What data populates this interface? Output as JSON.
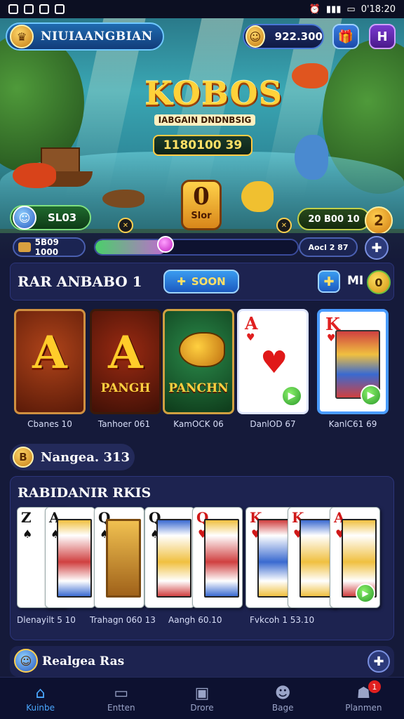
{
  "status_bar": {
    "time": "0'18:20"
  },
  "header": {
    "app_name": "NIUIAANGBIAN",
    "coins": "922.300",
    "menu_label": "H"
  },
  "hero": {
    "logo_title": "KOBOS",
    "logo_subtitle": "IABGAIN DNDNBSIG",
    "jackpot": "1180100 39",
    "slot_badge_number": "0",
    "slot_badge_label": "Slor",
    "slots_label": "SL03",
    "score": "20 B00 10",
    "score_bubble": "2"
  },
  "progress": {
    "balance": "5B09 1000",
    "level_text": "Aocl 2 87",
    "xp_fraction": 0.35
  },
  "section": {
    "title": "RAR ANBABO 1",
    "soon_button": "SOON",
    "m_label": "MI",
    "badge": "0"
  },
  "games": [
    {
      "letter": "A",
      "word": "",
      "caption": "Cbanes 10"
    },
    {
      "letter": "A",
      "word": "PANGH",
      "caption": "Tanhoer 061"
    },
    {
      "letter": "",
      "word": "PANCHN",
      "caption": "KamOCK 06"
    },
    {
      "letter": "A",
      "word": "",
      "caption": "DanlOD 67"
    },
    {
      "letter": "K",
      "word": "",
      "caption": "KanlC61 69"
    }
  ],
  "range": {
    "badge": "B",
    "label": "Nangea. 313"
  },
  "fan": {
    "title": "RABIDANIR RKIS",
    "cards": [
      {
        "rank": "Z",
        "suit": "♠",
        "color": "#111"
      },
      {
        "rank": "A",
        "suit": "♠",
        "color": "#111"
      },
      {
        "rank": "Q",
        "suit": "♠",
        "color": "#111"
      },
      {
        "rank": "Q",
        "suit": "♠",
        "color": "#111"
      },
      {
        "rank": "Q",
        "suit": "♥",
        "color": "#d01818"
      },
      {
        "rank": "K",
        "suit": "♥",
        "color": "#d01818"
      },
      {
        "rank": "K",
        "suit": "♥",
        "color": "#d01818"
      },
      {
        "rank": "A",
        "suit": "♥",
        "color": "#d01818"
      }
    ],
    "captions": [
      "Dlenayilt 5 10",
      "Trahagn 060 13",
      "Aangh 60.10",
      "Fvkcoh 1 53.10"
    ]
  },
  "region": {
    "label": "Realgea Ras"
  },
  "nav": {
    "items": [
      {
        "label": "Kuinbe",
        "icon": "home-icon"
      },
      {
        "label": "Entten",
        "icon": "frame-icon"
      },
      {
        "label": "Drore",
        "icon": "photo-icon"
      },
      {
        "label": "Bage",
        "icon": "people-icon"
      },
      {
        "label": "Planmen",
        "icon": "profile-icon"
      }
    ],
    "badge": "1"
  }
}
